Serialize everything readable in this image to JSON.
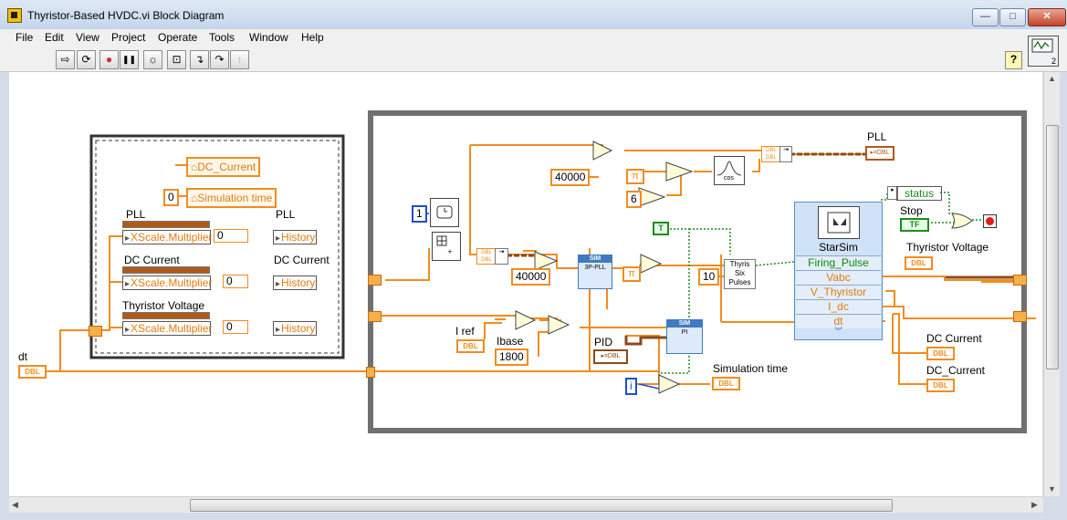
{
  "window": {
    "title": "Thyristor-Based HVDC.vi Block Diagram",
    "min_glyph": "—",
    "max_glyph": "□",
    "close_glyph": "✕"
  },
  "menu": [
    "File",
    "Edit",
    "View",
    "Project",
    "Operate",
    "Tools",
    "Window",
    "Help"
  ],
  "toolbar": {
    "run": "⇨",
    "run_continuous": "⟳",
    "abort": "●",
    "pause": "❚❚",
    "highlight": "☼",
    "retain": "⊡",
    "step_into": "↴",
    "step_over": "↷",
    "step_out": "↑"
  },
  "context_help_number": "2",
  "help_label": "?",
  "diagram": {
    "left_frame": {
      "top_refs": [
        "DC_Current",
        "Simulation time"
      ],
      "const_zero": "0",
      "groups": [
        {
          "left_label": "PLL",
          "right_label": "PLL",
          "property": "XScale.Multiplier",
          "index": "0",
          "history": "History"
        },
        {
          "left_label": "DC Current",
          "right_label": "DC Current",
          "property": "XScale.Multiplier",
          "index": "0",
          "history": "History"
        },
        {
          "left_label": "Thyristor Voltage",
          "property": "XScale.Multiplier",
          "index": "0",
          "history": "History"
        }
      ]
    },
    "dt_label": "dt",
    "dbl": "DBL",
    "const_one": "1",
    "const_40000_a": "40000",
    "const_40000_b": "40000",
    "const_6": "6",
    "const_10": "10",
    "const_1800": "1800",
    "pi": "π",
    "i_ref_label": "I ref",
    "ibase_label": "Ibase",
    "pid_label": "PID",
    "pid_ref": "PID",
    "sim_time_label": "Simulation time",
    "i_iter": "i",
    "pll_block": {
      "head": "SIM",
      "body": "3P-PLL"
    },
    "pi_block": {
      "head": "SIM",
      "body": "PI"
    },
    "thyris_block": "Thyris Six Pulses",
    "cos_label": "cos",
    "bool_true": "T",
    "status_label": "status",
    "stop_label": "Stop",
    "stop_bool": "TF",
    "starsim": {
      "title": "StarSim",
      "rows": [
        {
          "label": "Firing_Pulse",
          "color": "green"
        },
        {
          "label": "Vabc",
          "color": "orange"
        },
        {
          "label": "V_Thyristor",
          "color": "orange"
        },
        {
          "label": "I_dc",
          "color": "orange"
        },
        {
          "label": "dt",
          "color": "orange"
        }
      ],
      "more": "︾"
    },
    "pll_out_label": "PLL",
    "thyristor_voltage_label": "Thyristor Voltage",
    "dc_current_label": "DC Current",
    "dc_current_label2": "DC_Current"
  }
}
